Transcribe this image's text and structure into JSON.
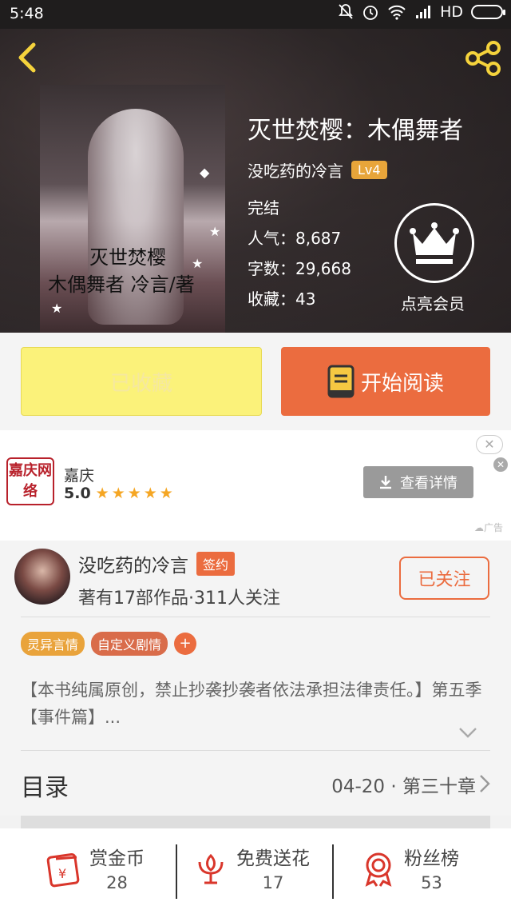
{
  "status_bar": {
    "time": "5:48",
    "network": "HD"
  },
  "book": {
    "title": "灭世焚樱：木偶舞者",
    "author": "没吃药的冷言",
    "author_level": "Lv4",
    "status": "完结",
    "popularity": "人气：8,687",
    "word_count": "字数：29,668",
    "favorites": "收藏：43",
    "cover_text_line1": "灭世焚樱",
    "cover_text_line2": "木偶舞者  冷言/著"
  },
  "vip": {
    "label": "点亮会员"
  },
  "actions": {
    "favorited_label": "已收藏",
    "read_label": "开始阅读"
  },
  "ad": {
    "logo_text": "嘉庆网络",
    "name": "嘉庆",
    "rating": "5.0",
    "stars": "★★★★★",
    "button_label": "查看详情",
    "tag": "广告"
  },
  "author_card": {
    "name": "没吃药的冷言",
    "badge": "签约",
    "stats": "著有17部作品·311人关注",
    "follow_label": "已关注"
  },
  "tags": [
    "灵异言情",
    "自定义剧情"
  ],
  "add_tag_label": "+",
  "description": "【本书纯属原创，禁止抄袭抄袭者依法承担法律责任。】第五季【事件篇】...",
  "toc": {
    "label": "目录",
    "latest": "04-20 · 第三十章"
  },
  "bottom_bar": [
    {
      "label": "赏金币",
      "count": "28",
      "icon": "reward-coin-icon"
    },
    {
      "label": "免费送花",
      "count": "17",
      "icon": "flower-icon"
    },
    {
      "label": "粉丝榜",
      "count": "53",
      "icon": "medal-icon"
    }
  ],
  "colors": {
    "accent": "#eb6c3f",
    "favorite_btn": "#fbf27a",
    "level_badge": "#e8a53a",
    "tag1": "#e9a33b"
  }
}
